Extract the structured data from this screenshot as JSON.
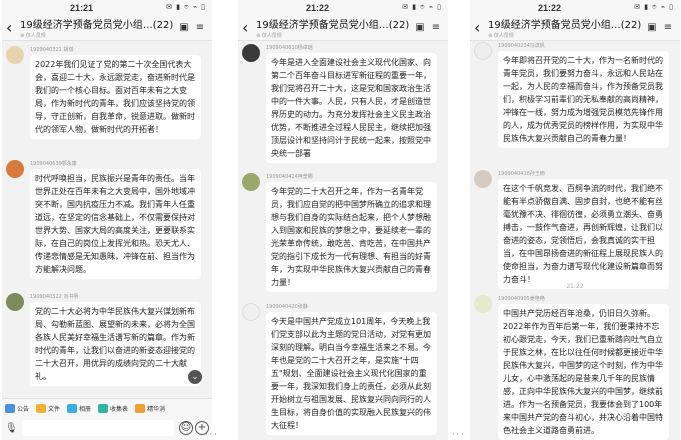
{
  "screens": [
    {
      "status": {
        "time": "21:21",
        "icons": "✉ ▮ ⌾ ⌁ ▯"
      },
      "chat": {
        "title": "19级经济学预备党员党小组…(22)",
        "subtitle": "⊕ 仅人员规"
      },
      "messages": [
        {
          "sender": "1909040321 胡琪",
          "avatar_color": "#e8d3b0",
          "text": "2022年我们见证了党的第二十次全国代表大会，喜迎二十大，永远跟党走，奋进新时代是我们的一个核心目标。面对百年未有之大变局，作为新时代的青年，我们应该坚持党的领导，守正创新，自我革命，锐意进取。做新时代的领军人物，做新时代的开拓者！"
        },
        {
          "sender": "1909040639郭永康",
          "avatar_color": "#d97a3a",
          "text": "时代呼唤担当，民族振兴是青年的责任。当年世界正处在百年未有之大变局中，国外地域冲突不断，国内抗疫压力不减。我们青年人任重道远，在坚定的信念基础上，不仅需要保持对世界大势、国家大局的高度关注，更要联系实际，在自己的岗位上发挥光和热。恐天尤人、传递悲情感是无知愚昧，冲锋在前、担当作为方能解决问题。"
        },
        {
          "sender": "1909040322 刘书明",
          "avatar_color": "#7d8a5a",
          "text": "党的二十大必将为中华民族伟大复兴谋划新布局、勾勒新蓝图、展望新的未来，必将为全国各族人民美好幸福生活谱写新的篇章。作为新时代的青年，让我们以奋进的新姿态迎接党的二十大召开，用优异的成绩向党的二十大献礼。"
        }
      ],
      "shortcuts": [
        "公告",
        "文件",
        "相册",
        "收集表",
        "精华消"
      ]
    },
    {
      "status": {
        "time": "21:22",
        "icons": "✉ ▮ ⌾ ⌁ ▯"
      },
      "chat": {
        "title": "19级经济学预备党员党小组…(22)",
        "subtitle": "⊕ 仅人员规"
      },
      "messages": [
        {
          "sender": "1909040610杨卓瑶",
          "avatar_color": "#3a3a3a",
          "text": "今年是进入全面建设社会主义现代化国家、向第二个百年奋斗目标进军新征程的重要一年，我们党将召开二十大，这是党和国家政治生活中的一件大事。人民，只有人民，才是创造世界历史的动力。为充分发挥社会主义民主政治优势，不断推进全过程人民民主，继续把加强顶层设计和坚持问计于民统一起来，按照党中央统一部署"
        },
        {
          "sender": "1909040424冉莹娜",
          "avatar_color": "#9aa86a",
          "text": "今年党的二十大召开之年，作为一名青年党员，我们应自觉的把中国梦所确立的追求和理想与我们自身的实际结合起来，把个人梦想融入到国家和民族的梦想之中，要延续老一辈的光荣革命传统，敢吃苦、肯吃苦，在中国共产党的指引下成长为一代有理想、有担当的好青年，为实现中华民族伟大复兴贡献自己的青春力量！"
        },
        {
          "sender": "1909040420张静",
          "avatar_color": "#f0f0f0",
          "text": "今天是中国共产党成立101周年，今天晚上我们党支部以此为主题的党日活动，对党有更加深刻的理解。明白当今幸福生活来之不易。今年也是党的二十大召开之年，是实施\"十四五\"规划、全面建设社会主义现代化国家的重要一年，我深知我们身上的责任，必须从此刻开始树立与祖国发展、民族复兴同向同行的人生目标，将自身价值的实现融入民族复兴的伟大征程！"
        }
      ]
    },
    {
      "status": {
        "time": "21:22",
        "icons": "✉ ▮ ⌾ ⌁ ▯"
      },
      "chat": {
        "title": "19级经济学预备党员党小组…(22)",
        "subtitle": "⊕ 仅人员规"
      },
      "messages": [
        {
          "sender": "1909040234冯滨帆",
          "avatar_color": "#eeeeee",
          "text": "今年即将召开党的二十大，作为一名新时代的青年党员，我们要努力奋斗，永远和人民站在一起，为人民的幸福而奋斗，作为预备党员我们，积极学习前辈们的无私奉献的高尚精神，冲锋在一线，努力成为增强党员模范先锋作用的人，成为优秀党员的榜样作用，为实现中华民族伟大复兴贡献自己的青春力量！"
        },
        {
          "sender": "1909040418孙王楠",
          "avatar_color": "#d8c8c0",
          "text": "在这个千帆竞发、百舸争流的时代，我们绝不能有半点骄傲自满、固步自封，也绝不能有丝毫犹豫不决、徘徊彷徨，必须勇立潮头、奋勇搏击，一鼓作气奋进，再创新辉煌，让我们以奋进的姿态，党领悟后，会我真诚的实干担当，在中国昂扬奋进的新征程上展现民族人的使命担当，为奋力谱写现代化建设新篇章而努力奋斗！"
        },
        {
          "sender": "1909040905姜艳艳",
          "avatar_color": "#e4ead0",
          "text": "中国共产党历经百年沧桑，仍旧日久弥新。2022年作为百年后第一年，我们要秉持不忘初心跟党走，今天，我们已重新踏向吐气自立于民族之林，在比以往任何时候都更接近中华民族伟大复兴，中国梦的这个时刻，作为中华儿女，心中激荡起的是昔来几千年的民族情感，正向中华民族伟大复兴的中国梦，继续前进。作为一名预备党员，我要体会到了100年来中国共产党的奋斗初心，并决心沿着中国特色社会主义道路奋勇前进。"
        }
      ],
      "time_divider": "21:22"
    }
  ]
}
